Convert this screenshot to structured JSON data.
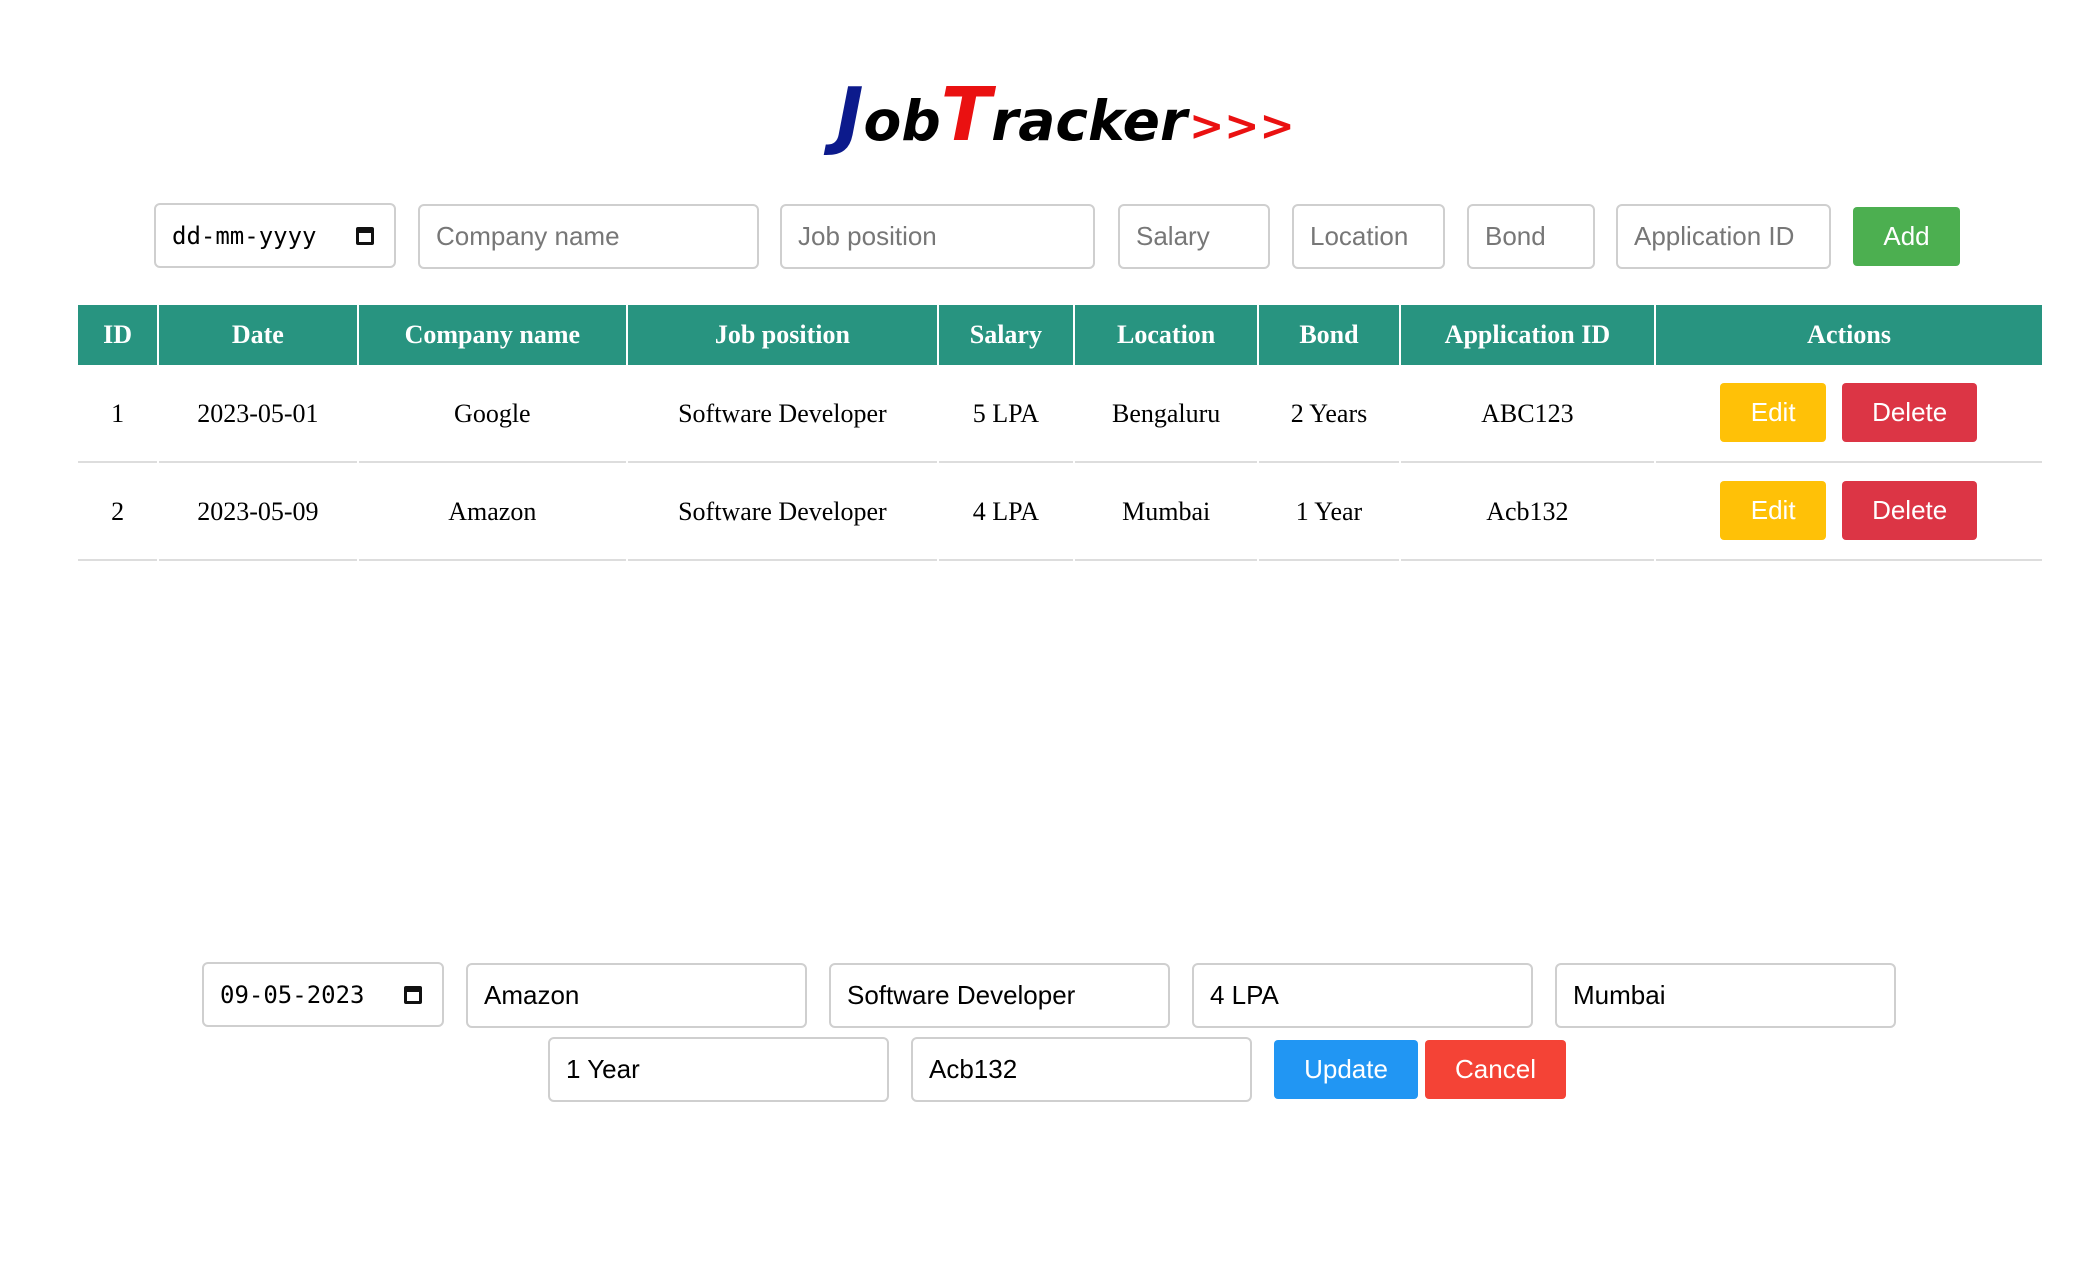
{
  "logo": {
    "j": "J",
    "ob": "ob",
    "t": "T",
    "racker": "racker",
    "arrows": ">>>"
  },
  "add_form": {
    "date_placeholder": "dd-mm-yyyy",
    "company_placeholder": "Company name",
    "position_placeholder": "Job position",
    "salary_placeholder": "Salary",
    "location_placeholder": "Location",
    "bond_placeholder": "Bond",
    "appid_placeholder": "Application ID",
    "add_label": "Add"
  },
  "table": {
    "headers": [
      "ID",
      "Date",
      "Company name",
      "Job position",
      "Salary",
      "Location",
      "Bond",
      "Application ID",
      "Actions"
    ],
    "rows": [
      {
        "id": "1",
        "date": "2023-05-01",
        "company": "Google",
        "position": "Software Developer",
        "salary": "5 LPA",
        "location": "Bengaluru",
        "bond": "2 Years",
        "appid": "ABC123"
      },
      {
        "id": "2",
        "date": "2023-05-09",
        "company": "Amazon",
        "position": "Software Developer",
        "salary": "4 LPA",
        "location": "Mumbai",
        "bond": "1 Year",
        "appid": "Acb132"
      }
    ],
    "edit_label": "Edit",
    "delete_label": "Delete"
  },
  "edit_form": {
    "date": "09-05-2023",
    "company": "Amazon",
    "position": "Software Developer",
    "salary": "4 LPA",
    "location": "Mumbai",
    "bond": "1 Year",
    "appid": "Acb132",
    "update_label": "Update",
    "cancel_label": "Cancel"
  },
  "colors": {
    "header_bg": "#289480",
    "add": "#4caf50",
    "edit": "#ffc107",
    "delete": "#dc3545",
    "update": "#2196f3",
    "cancel": "#f44336",
    "logo_blue": "#0c1a8c",
    "logo_red": "#ea1111"
  }
}
